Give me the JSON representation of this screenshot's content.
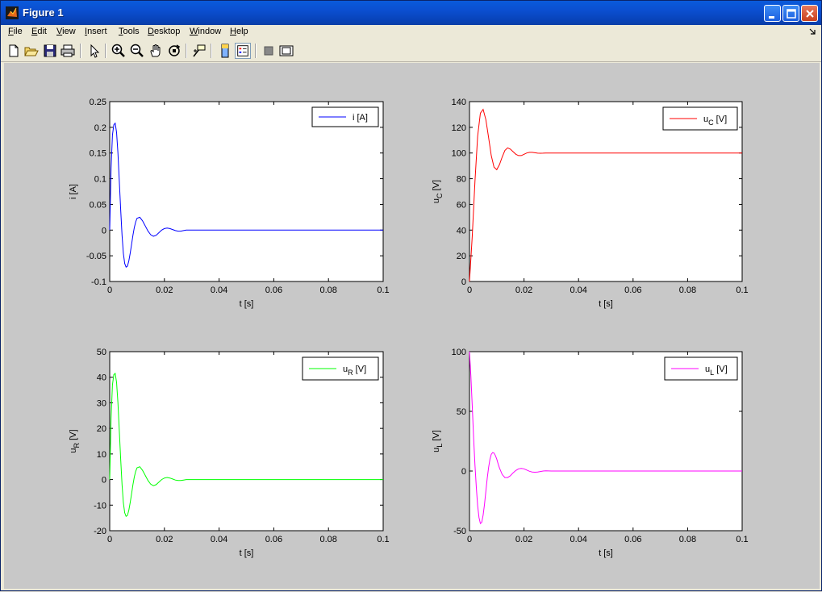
{
  "window": {
    "title": "Figure 1"
  },
  "menu": [
    {
      "label": "File",
      "u": "F",
      "rest": "ile"
    },
    {
      "label": "Edit",
      "u": "E",
      "rest": "dit"
    },
    {
      "label": "View",
      "u": "V",
      "rest": "iew"
    },
    {
      "label": "Insert",
      "u": "I",
      "rest": "nsert"
    },
    {
      "label": "Tools",
      "u": "T",
      "rest": "ools"
    },
    {
      "label": "Desktop",
      "u": "D",
      "rest": "esktop"
    },
    {
      "label": "Window",
      "u": "W",
      "rest": "indow"
    },
    {
      "label": "Help",
      "u": "H",
      "rest": "elp"
    }
  ],
  "toolbar": {
    "icons": [
      "new-figure-icon",
      "open-file-icon",
      "save-icon",
      "print-icon",
      "edit-plot-arrow-icon",
      "zoom-in-icon",
      "zoom-out-icon",
      "pan-hand-icon",
      "rotate-3d-icon",
      "data-cursor-icon",
      "colorbar-icon",
      "legend-icon",
      "hide-plot-tools-icon",
      "show-plot-tools-icon"
    ]
  },
  "chart_data": [
    {
      "type": "line",
      "xlabel": "t [s]",
      "ylabel": "i [A]",
      "legend": "i [A]",
      "legend_position": "top-right",
      "color": "#0000ff",
      "xlim": [
        0,
        0.1
      ],
      "ylim": [
        -0.1,
        0.25
      ],
      "xticks": [
        "0",
        "0.02",
        "0.04",
        "0.06",
        "0.08",
        "0.1"
      ],
      "yticks": [
        "-0.1",
        "-0.05",
        "0",
        "0.05",
        "0.1",
        "0.15",
        "0.2",
        "0.25"
      ],
      "grid": false,
      "x": [
        0,
        0.0005,
        0.001,
        0.0015,
        0.002,
        0.0025,
        0.003,
        0.0035,
        0.004,
        0.0045,
        0.005,
        0.0055,
        0.006,
        0.0065,
        0.007,
        0.0075,
        0.008,
        0.0085,
        0.009,
        0.0095,
        0.01,
        0.011,
        0.012,
        0.0125,
        0.013,
        0.014,
        0.015,
        0.016,
        0.017,
        0.018,
        0.019,
        0.02,
        0.021,
        0.022,
        0.023,
        0.024,
        0.025,
        0.026,
        0.027,
        0.028,
        0.029,
        0.03,
        0.04,
        0.06,
        0.08,
        0.1
      ],
      "y": [
        0,
        0.12,
        0.185,
        0.205,
        0.208,
        0.19,
        0.15,
        0.095,
        0.04,
        -0.01,
        -0.045,
        -0.065,
        -0.072,
        -0.07,
        -0.06,
        -0.045,
        -0.028,
        -0.01,
        0.005,
        0.016,
        0.023,
        0.025,
        0.018,
        0.013,
        0.008,
        -0.002,
        -0.009,
        -0.012,
        -0.01,
        -0.005,
        0.0,
        0.003,
        0.004,
        0.003,
        0.001,
        -0.001,
        -0.002,
        -0.002,
        -0.001,
        0.0,
        0.0,
        0.0,
        0.0,
        0.0,
        0.0,
        0.0
      ]
    },
    {
      "type": "line",
      "xlabel": "t [s]",
      "ylabel": "u",
      "ylabel_sub": "C",
      "ylabel_unit": "[V]",
      "legend": "u",
      "legend_sub": "C",
      "legend_unit": "[V]",
      "legend_position": "top-right",
      "color": "#ff0000",
      "xlim": [
        0,
        0.1
      ],
      "ylim": [
        0,
        140
      ],
      "xticks": [
        "0",
        "0.02",
        "0.04",
        "0.06",
        "0.08",
        "0.1"
      ],
      "yticks": [
        "0",
        "20",
        "40",
        "60",
        "80",
        "100",
        "120",
        "140"
      ],
      "grid": false,
      "x": [
        0,
        0.001,
        0.002,
        0.003,
        0.004,
        0.005,
        0.006,
        0.007,
        0.008,
        0.009,
        0.01,
        0.011,
        0.012,
        0.013,
        0.014,
        0.015,
        0.016,
        0.017,
        0.018,
        0.019,
        0.02,
        0.021,
        0.022,
        0.023,
        0.024,
        0.025,
        0.026,
        0.027,
        0.028,
        0.03,
        0.04,
        0.06,
        0.08,
        0.1
      ],
      "y": [
        0,
        35,
        78,
        113,
        131,
        134,
        126,
        112,
        98,
        89,
        87,
        91,
        97,
        102,
        104,
        103,
        101,
        99,
        98,
        98,
        99,
        100,
        100.5,
        100.5,
        100.2,
        99.9,
        99.8,
        99.9,
        100,
        100,
        100,
        100,
        100,
        100
      ]
    },
    {
      "type": "line",
      "xlabel": "t [s]",
      "ylabel": "u",
      "ylabel_sub": "R",
      "ylabel_unit": "[V]",
      "legend": "u",
      "legend_sub": "R",
      "legend_unit": "[V]",
      "legend_position": "top-right",
      "color": "#00ff00",
      "xlim": [
        0,
        0.1
      ],
      "ylim": [
        -20,
        50
      ],
      "xticks": [
        "0",
        "0.02",
        "0.04",
        "0.06",
        "0.08",
        "0.1"
      ],
      "yticks": [
        "-20",
        "-10",
        "0",
        "10",
        "20",
        "30",
        "40",
        "50"
      ],
      "grid": false,
      "x": [
        0,
        0.0005,
        0.001,
        0.0015,
        0.002,
        0.0025,
        0.003,
        0.0035,
        0.004,
        0.0045,
        0.005,
        0.0055,
        0.006,
        0.0065,
        0.007,
        0.0075,
        0.008,
        0.0085,
        0.009,
        0.0095,
        0.01,
        0.011,
        0.012,
        0.0125,
        0.013,
        0.014,
        0.015,
        0.016,
        0.017,
        0.018,
        0.019,
        0.02,
        0.021,
        0.022,
        0.023,
        0.024,
        0.025,
        0.026,
        0.027,
        0.028,
        0.029,
        0.03,
        0.04,
        0.06,
        0.08,
        0.1
      ],
      "y": [
        0,
        24,
        37,
        41,
        41.5,
        38,
        30,
        19,
        8,
        -2,
        -9,
        -13,
        -14.4,
        -14,
        -12,
        -9,
        -5.6,
        -2,
        1,
        3.2,
        4.6,
        5,
        3.6,
        2.6,
        1.6,
        -0.4,
        -1.8,
        -2.4,
        -2,
        -1,
        0,
        0.6,
        0.8,
        0.6,
        0.2,
        -0.2,
        -0.4,
        -0.4,
        -0.2,
        0,
        0,
        0,
        0,
        0,
        0,
        0
      ]
    },
    {
      "type": "line",
      "xlabel": "t [s]",
      "ylabel": "u",
      "ylabel_sub": "L",
      "ylabel_unit": "[V]",
      "legend": "u",
      "legend_sub": "L",
      "legend_unit": "[V]",
      "legend_position": "top-right",
      "color": "#ff00ff",
      "xlim": [
        0,
        0.1
      ],
      "ylim": [
        -50,
        100
      ],
      "xticks": [
        "0",
        "0.02",
        "0.04",
        "0.06",
        "0.08",
        "0.1"
      ],
      "yticks": [
        "-50",
        "0",
        "50",
        "100"
      ],
      "grid": false,
      "x": [
        0,
        0.0005,
        0.001,
        0.0015,
        0.002,
        0.0025,
        0.003,
        0.0035,
        0.004,
        0.0045,
        0.005,
        0.0055,
        0.006,
        0.0065,
        0.007,
        0.0075,
        0.008,
        0.0085,
        0.009,
        0.0095,
        0.01,
        0.0105,
        0.011,
        0.012,
        0.013,
        0.014,
        0.015,
        0.016,
        0.017,
        0.018,
        0.019,
        0.02,
        0.021,
        0.022,
        0.023,
        0.024,
        0.025,
        0.026,
        0.027,
        0.028,
        0.03,
        0.04,
        0.06,
        0.08,
        0.1
      ],
      "y": [
        100,
        80,
        55,
        28,
        5,
        -14,
        -29,
        -39,
        -44,
        -43,
        -37,
        -28,
        -17,
        -6,
        3,
        10,
        14,
        15.5,
        15,
        13,
        10,
        6,
        2.5,
        -3,
        -5.5,
        -5.5,
        -4,
        -1.5,
        0.5,
        1.8,
        2.2,
        1.8,
        0.8,
        -0.2,
        -0.8,
        -1,
        -0.8,
        -0.4,
        0,
        0.2,
        0,
        0,
        0,
        0,
        0
      ]
    }
  ]
}
